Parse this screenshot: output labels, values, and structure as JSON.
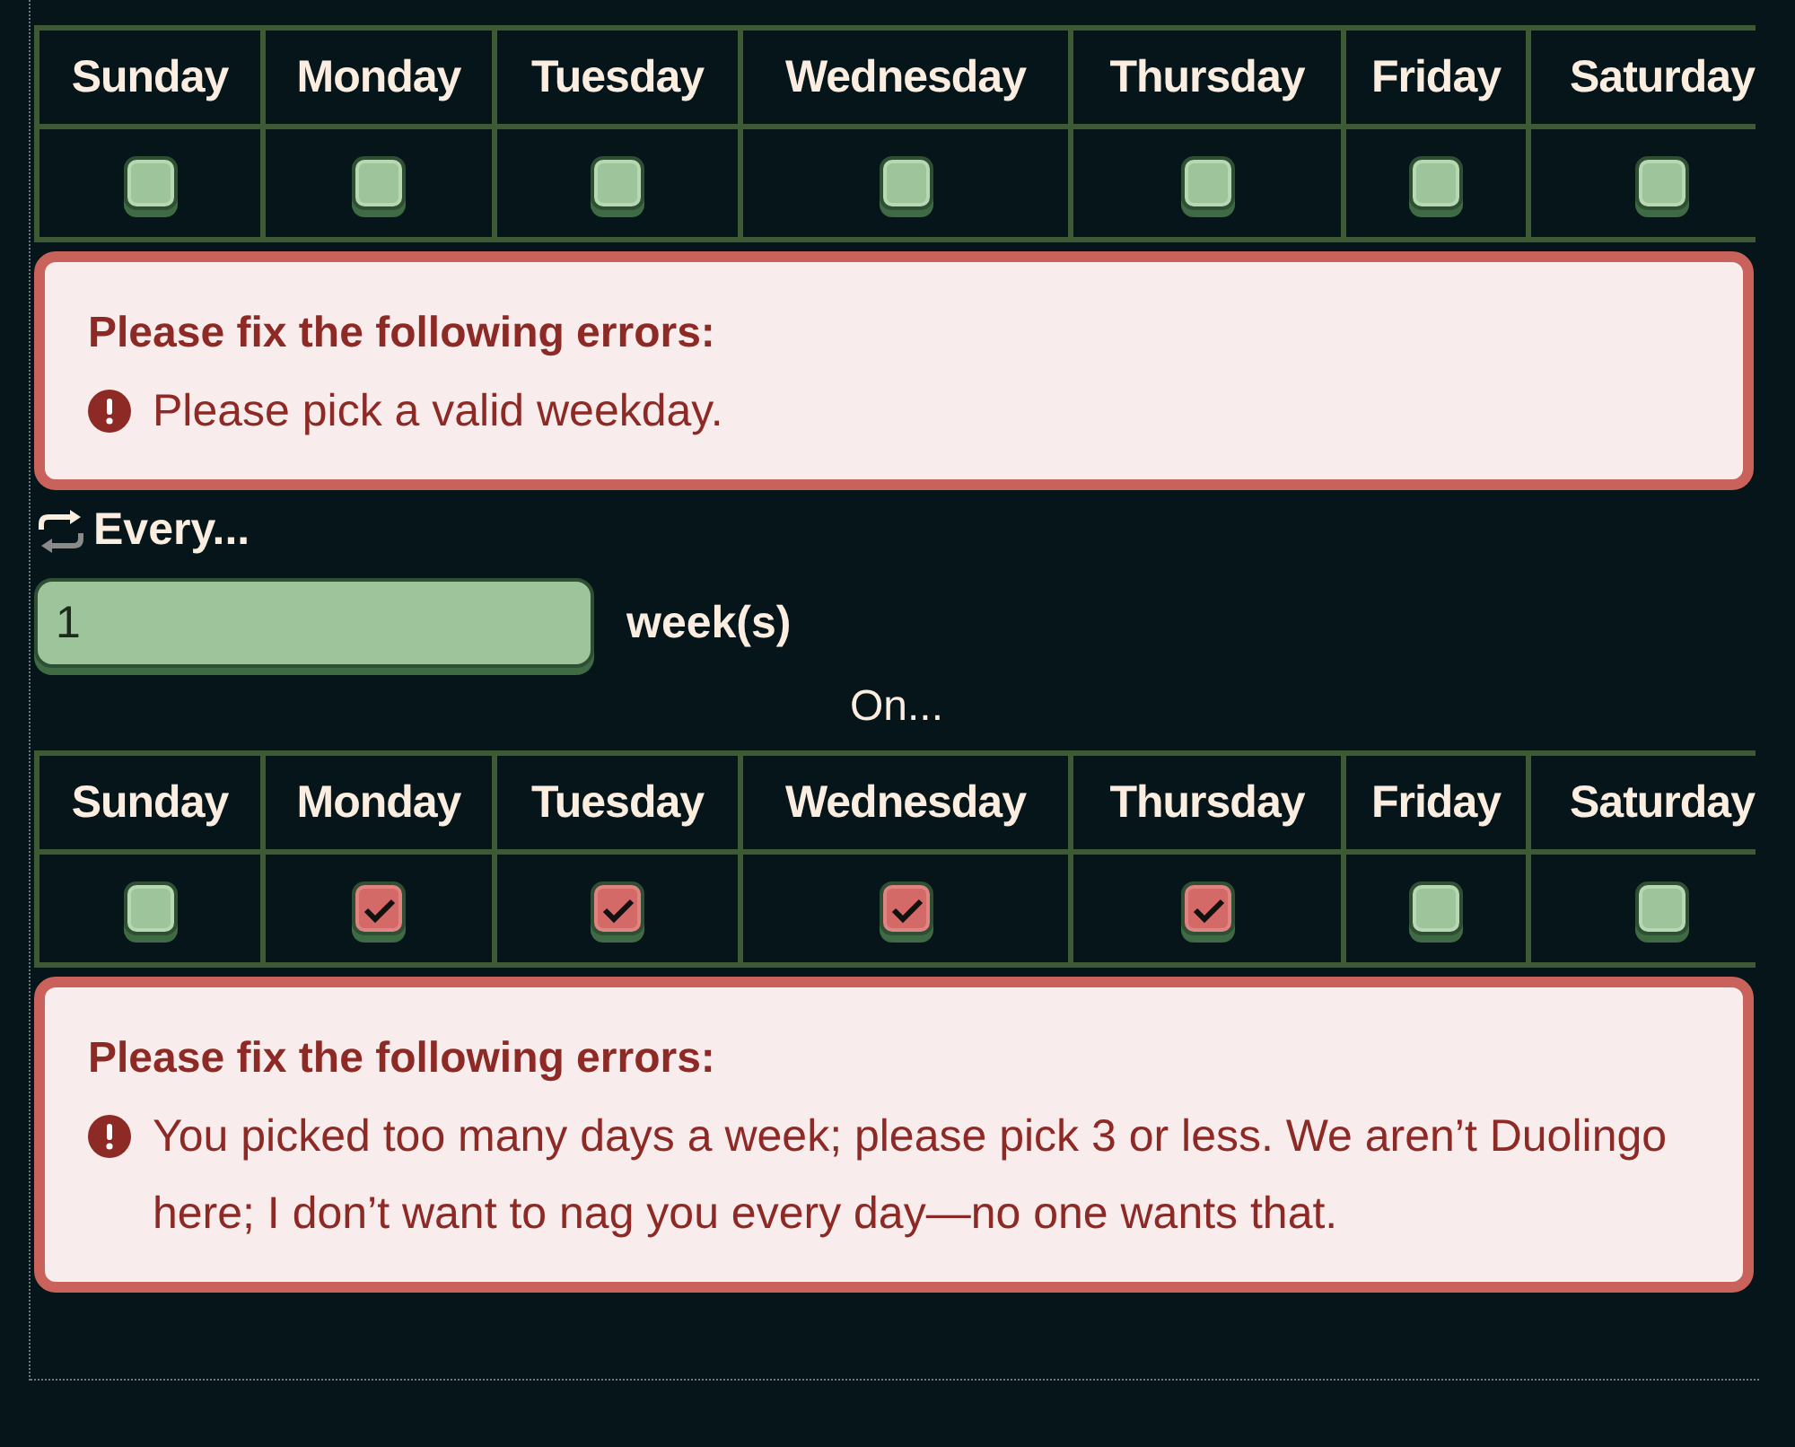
{
  "blocks": [
    {
      "kind": "days",
      "days": [
        {
          "label": "Sunday",
          "checked": false
        },
        {
          "label": "Monday",
          "checked": false
        },
        {
          "label": "Tuesday",
          "checked": false
        },
        {
          "label": "Wednesday",
          "checked": false
        },
        {
          "label": "Thursday",
          "checked": false
        },
        {
          "label": "Friday",
          "checked": false
        },
        {
          "label": "Saturday",
          "checked": false
        }
      ]
    },
    {
      "kind": "errors",
      "title": "Please fix the following errors:",
      "messages": [
        "Please pick a valid weekday."
      ]
    },
    {
      "kind": "interval",
      "label": "Every...",
      "value": "1",
      "unit": "week(s)"
    },
    {
      "kind": "caption",
      "text": "On..."
    },
    {
      "kind": "days",
      "days": [
        {
          "label": "Sunday",
          "checked": false
        },
        {
          "label": "Monday",
          "checked": true
        },
        {
          "label": "Tuesday",
          "checked": true
        },
        {
          "label": "Wednesday",
          "checked": true
        },
        {
          "label": "Thursday",
          "checked": true
        },
        {
          "label": "Friday",
          "checked": false
        },
        {
          "label": "Saturday",
          "checked": false
        }
      ]
    },
    {
      "kind": "errors",
      "title": "Please fix the following errors:",
      "messages": [
        "You picked too many days a week; please pick 3 or less. We aren’t Duolingo here; I don’t want to nag you every day—no one wants that."
      ]
    }
  ]
}
